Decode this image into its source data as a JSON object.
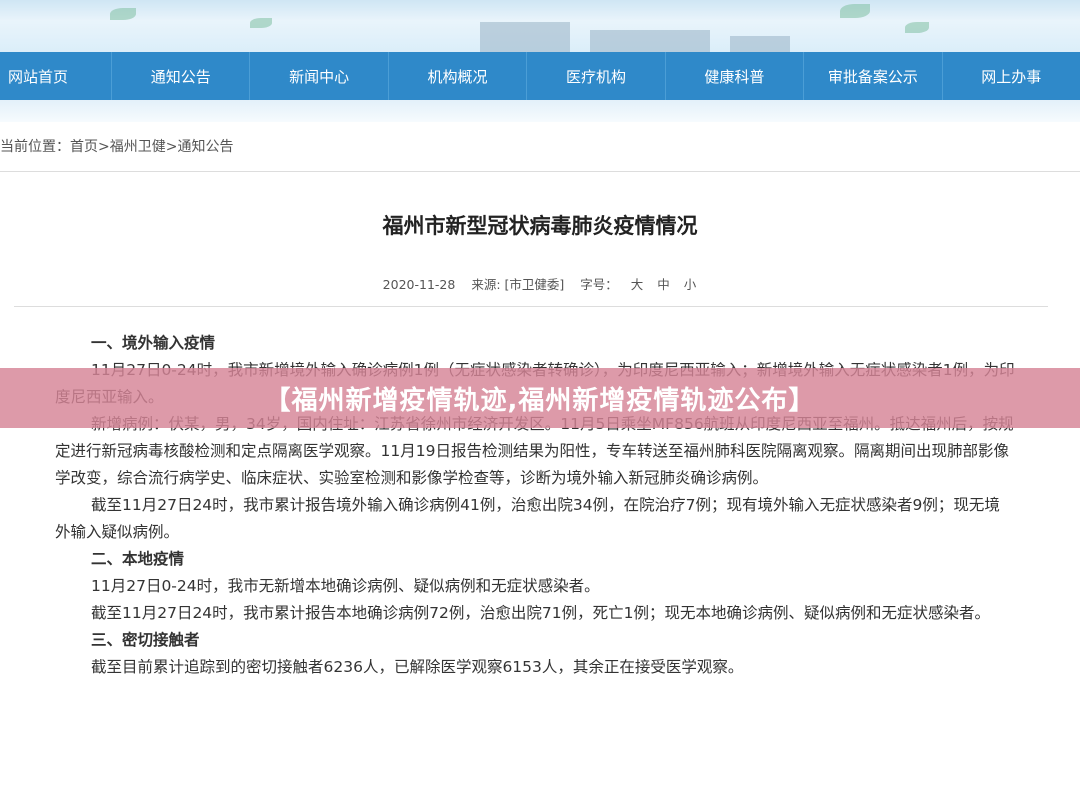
{
  "nav": {
    "items": [
      "网站首页",
      "通知公告",
      "新闻中心",
      "机构概况",
      "医疗机构",
      "健康科普",
      "审批备案公示",
      "网上办事"
    ]
  },
  "breadcrumb": {
    "prefix": "当前位置：",
    "home": "首页",
    "sep": ">",
    "level2": "福州卫健",
    "level3": "通知公告"
  },
  "article": {
    "title": "福州市新型冠状病毒肺炎疫情情况",
    "date": "2020-11-28",
    "source": "来源: [市卫健委]",
    "font_size_label": "字号：",
    "font_sizes": [
      "大",
      "中",
      "小"
    ],
    "paragraphs": [
      {
        "type": "heading",
        "text": "一、境外输入疫情"
      },
      {
        "type": "indent",
        "text": "11月27日0-24时，我市新增境外输入确诊病例1例（无症状感染者转确诊），为印度尼西亚输入；新增境外输入无症状感染者1例，为印度尼西亚输入。"
      },
      {
        "type": "indent",
        "text": "新增病例：伏某，男，34岁，国内住址：江苏省徐州市经济开发区。11月5日乘坐MF856航班从印度尼西亚至福州。抵达福州后，按规定进行新冠病毒核酸检测和定点隔离医学观察。11月19日报告检测结果为阳性，专车转送至福州肺科医院隔离观察。隔离期间出现肺部影像学改变，综合流行病学史、临床症状、实验室检测和影像学检查等，诊断为境外输入新冠肺炎确诊病例。"
      },
      {
        "type": "indent",
        "text": "截至11月27日24时，我市累计报告境外输入确诊病例41例，治愈出院34例，在院治疗7例；现有境外输入无症状感染者9例；现无境外输入疑似病例。"
      },
      {
        "type": "heading",
        "text": "二、本地疫情"
      },
      {
        "type": "indent",
        "text": "11月27日0-24时，我市无新增本地确诊病例、疑似病例和无症状感染者。"
      },
      {
        "type": "indent",
        "text": "截至11月27日24时，我市累计报告本地确诊病例72例，治愈出院71例，死亡1例；现无本地确诊病例、疑似病例和无症状感染者。"
      },
      {
        "type": "heading",
        "text": "三、密切接触者"
      },
      {
        "type": "indent",
        "text": "截至目前累计追踪到的密切接触者6236人，已解除医学观察6153人，其余正在接受医学观察。"
      }
    ]
  },
  "overlay": {
    "text": "【福州新增疫情轨迹,福州新增疫情轨迹公布】"
  },
  "colors": {
    "nav_bg": "#2f89c9",
    "overlay_bg": "#d68496"
  }
}
